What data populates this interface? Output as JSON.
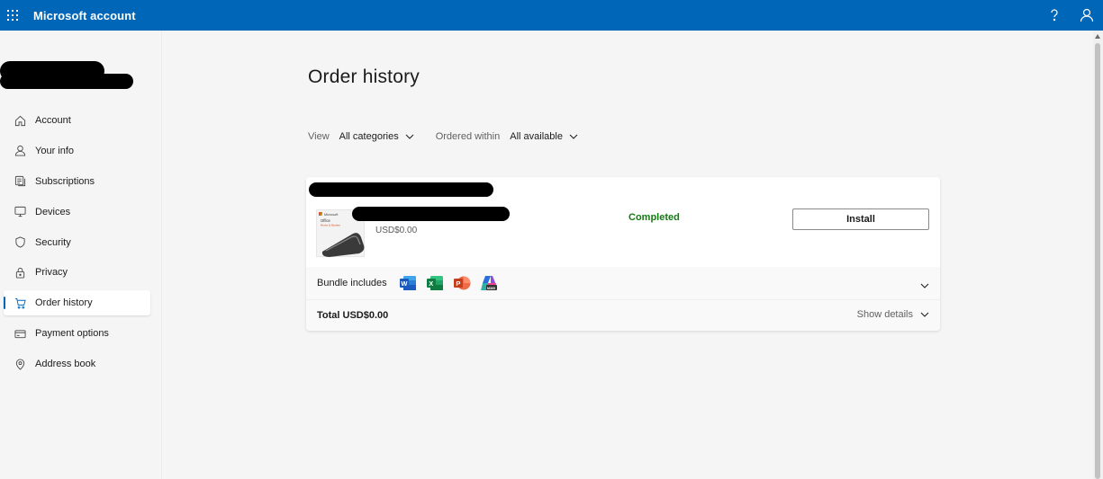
{
  "header": {
    "app_title": "Microsoft account",
    "icons": [
      "waffle-icon",
      "help-icon",
      "profile-icon"
    ]
  },
  "sidebar": {
    "items": [
      {
        "label": "Account",
        "icon": "home-icon"
      },
      {
        "label": "Your info",
        "icon": "person-icon"
      },
      {
        "label": "Subscriptions",
        "icon": "subscriptions-icon"
      },
      {
        "label": "Devices",
        "icon": "monitor-icon"
      },
      {
        "label": "Security",
        "icon": "shield-icon"
      },
      {
        "label": "Privacy",
        "icon": "lock-icon"
      },
      {
        "label": "Order history",
        "icon": "cart-icon",
        "active": true
      },
      {
        "label": "Payment options",
        "icon": "card-icon"
      },
      {
        "label": "Address book",
        "icon": "location-pin-icon"
      }
    ]
  },
  "main": {
    "title": "Order history",
    "filters": {
      "view_label": "View",
      "view_value": "All categories",
      "ordered_label": "Ordered within",
      "ordered_value": "All available"
    },
    "order": {
      "price": "USD$0.00",
      "status": "Completed",
      "install_label": "Install",
      "bundle_label": "Bundle includes",
      "bundle_apps": [
        "word-icon",
        "excel-icon",
        "powerpoint-icon",
        "copilot-icon"
      ],
      "total_label": "Total USD$0.00",
      "show_details_label": "Show details",
      "product_image_text": {
        "brand": "Microsoft",
        "product": "Office",
        "edition": "Home & Student"
      }
    }
  },
  "colors": {
    "accent": "#0067b8",
    "status_green": "#107c10",
    "background": "#f5f5f5",
    "card": "#ffffff"
  }
}
